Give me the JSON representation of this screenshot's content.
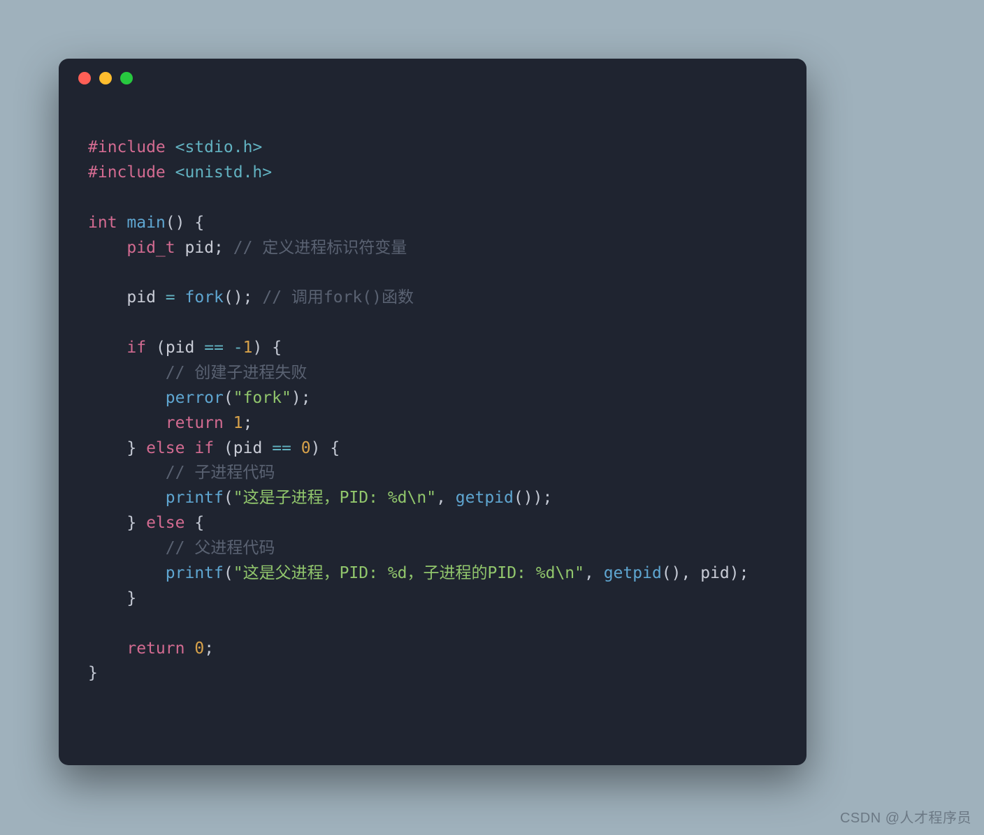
{
  "window": {
    "dots": [
      "red",
      "yellow",
      "green"
    ]
  },
  "code": {
    "include1_directive": "#include",
    "include1_header": "<stdio.h>",
    "include2_directive": "#include",
    "include2_header": "<unistd.h>",
    "main_ret_type": "int",
    "main_name": "main",
    "main_sig_open": "(",
    "main_sig_close": ")",
    "brace_open": "{",
    "brace_close": "}",
    "decl_type": "pid_t",
    "decl_name": "pid",
    "semicolon": ";",
    "comment_decl": "// 定义进程标识符变量",
    "assign_lhs": "pid",
    "assign_op": "=",
    "fork_name": "fork",
    "call_open": "(",
    "call_close": ")",
    "comment_fork": "// 调用fork()函数",
    "kw_if": "if",
    "kw_else": "else",
    "kw_return": "return",
    "cond1_lhs": "pid",
    "cond1_op": "==",
    "cond1_rhs_neg": "-",
    "cond1_rhs_num": "1",
    "comment_fail": "// 创建子进程失败",
    "perror_name": "perror",
    "perror_arg": "\"fork\"",
    "return1_num": "1",
    "cond2_lhs": "pid",
    "cond2_op": "==",
    "cond2_rhs": "0",
    "comment_child": "// 子进程代码",
    "printf_name": "printf",
    "printf_child_arg": "\"这是子进程，PID: %d\\n\"",
    "getpid_name": "getpid",
    "comment_parent": "// 父进程代码",
    "printf_parent_arg": "\"这是父进程，PID: %d，子进程的PID: %d\\n\"",
    "pid_ident": "pid",
    "return0_num": "0",
    "comma": ","
  },
  "watermark": "CSDN @人才程序员"
}
